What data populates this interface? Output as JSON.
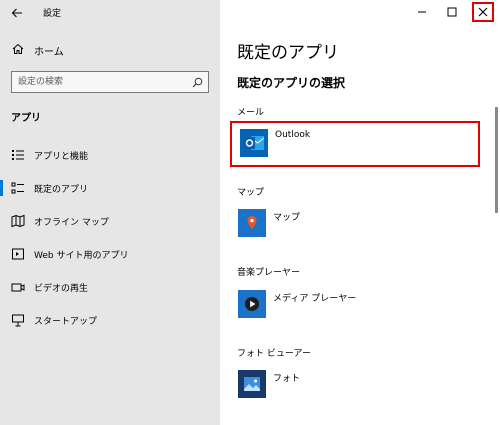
{
  "app": {
    "title": "設定"
  },
  "sidebar": {
    "home_label": "ホーム",
    "search_placeholder": "設定の検索",
    "section_title": "アプリ",
    "items": [
      {
        "label": "アプリと機能",
        "icon": "apps-features-icon"
      },
      {
        "label": "既定のアプリ",
        "icon": "default-apps-icon",
        "selected": true
      },
      {
        "label": "オフライン マップ",
        "icon": "offline-maps-icon"
      },
      {
        "label": "Web サイト用のアプリ",
        "icon": "apps-for-websites-icon"
      },
      {
        "label": "ビデオの再生",
        "icon": "video-playback-icon"
      },
      {
        "label": "スタートアップ",
        "icon": "startup-icon"
      }
    ]
  },
  "main": {
    "page_title": "既定のアプリ",
    "sub_title": "既定のアプリの選択",
    "categories": [
      {
        "label": "メール",
        "app": "Outlook",
        "icon": "outlook-icon",
        "highlighted": true
      },
      {
        "label": "マップ",
        "app": "マップ",
        "icon": "maps-icon"
      },
      {
        "label": "音楽プレーヤー",
        "app": "メディア プレーヤー",
        "icon": "media-player-icon"
      },
      {
        "label": "フォト ビューアー",
        "app": "フォト",
        "icon": "photos-icon"
      }
    ]
  },
  "colors": {
    "sidebar_bg": "#e6e6e6",
    "accent": "#0078d7",
    "highlight": "#e30000",
    "tile_blue": "#1a73c8"
  }
}
